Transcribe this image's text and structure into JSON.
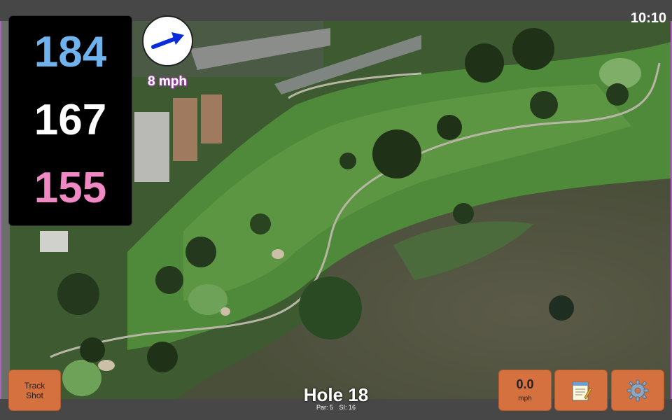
{
  "status": {
    "time": "10:10"
  },
  "distances": {
    "back": "184",
    "middle": "167",
    "front": "155"
  },
  "wind": {
    "speed": "8 mph",
    "direction_icon": "wind-arrow-icon"
  },
  "buttons": {
    "track_shot_label": "Track Shot",
    "speed_value": "0.0",
    "speed_unit": "mph",
    "notes_icon": "notepad-icon",
    "settings_icon": "gear-icon"
  },
  "hole": {
    "title": "Hole 18",
    "par": "Par: 5",
    "si": "SI: 16"
  },
  "colors": {
    "back": "#6fb2ee",
    "middle": "#ffffff",
    "front": "#f088c4",
    "button": "#d4713f",
    "accent": "#b040c0"
  }
}
